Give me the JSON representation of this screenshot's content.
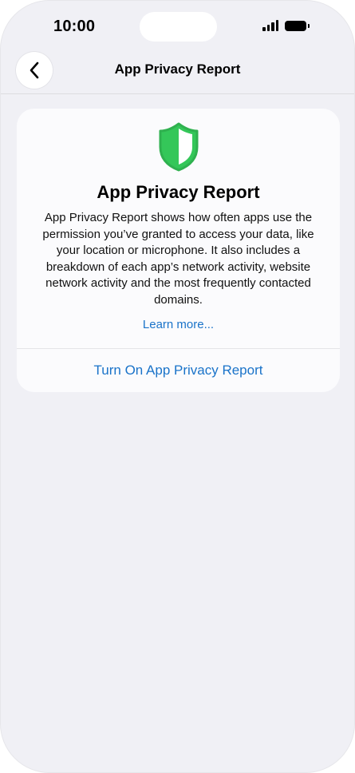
{
  "status_bar": {
    "time": "10:00"
  },
  "nav": {
    "title": "App Privacy Report",
    "back_icon": "chevron-left-icon"
  },
  "card": {
    "icon": "shield-icon",
    "icon_color": "#34c759",
    "title": "App Privacy Report",
    "description": "App Privacy Report shows how often apps use the permission you’ve granted to access your data, like your location or microphone. It also includes a breakdown of each app’s network activity, website network activity and the most frequently contacted domains.",
    "learn_more": "Learn more...",
    "turn_on": "Turn On App Privacy Report"
  },
  "colors": {
    "background": "#f0f0f5",
    "card": "#fbfbfd",
    "link": "#1a73c9"
  }
}
